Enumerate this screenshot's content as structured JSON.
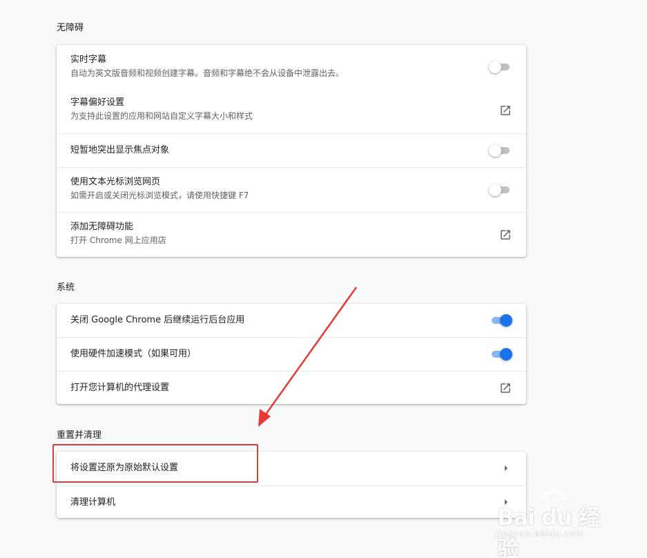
{
  "sections": {
    "accessibility": {
      "title": "无障碍",
      "live_caption": {
        "label": "实时字幕",
        "sub": "自动为英文版音频和视频创建字幕。音频和字幕绝不会从设备中泄露出去。",
        "enabled": false
      },
      "caption_prefs": {
        "label": "字幕偏好设置",
        "sub": "为支持此设置的应用和网站自定义字幕大小和样式"
      },
      "focus_highlight": {
        "label": "短暂地突出显示焦点对象",
        "enabled": false
      },
      "caret_browsing": {
        "label": "使用文本光标浏览网页",
        "sub": "如需开启或关闭光标浏览模式，请使用快捷键 F7",
        "enabled": false
      },
      "add_accessibility": {
        "label": "添加无障碍功能",
        "sub": "打开 Chrome 网上应用店"
      }
    },
    "system": {
      "title": "系统",
      "background_apps": {
        "label": "关闭 Google Chrome 后继续运行后台应用",
        "enabled": true
      },
      "hardware_accel": {
        "label": "使用硬件加速模式（如果可用）",
        "enabled": true
      },
      "proxy": {
        "label": "打开您计算机的代理设置"
      }
    },
    "reset": {
      "title": "重置并清理",
      "restore_defaults": {
        "label": "将设置还原为原始默认设置"
      },
      "cleanup": {
        "label": "清理计算机"
      }
    }
  },
  "watermark": {
    "logo_text": "Bai du 经验",
    "url": "jingyan.baidu.com"
  },
  "colors": {
    "accent": "#1a73e8",
    "toggle_on_track": "#8ab4f8",
    "toggle_off_track": "#bdc1c6",
    "annotation_red": "#e53935"
  },
  "icons": {
    "external_link": "open-in-new-icon",
    "arrow": "arrow-right-icon"
  }
}
